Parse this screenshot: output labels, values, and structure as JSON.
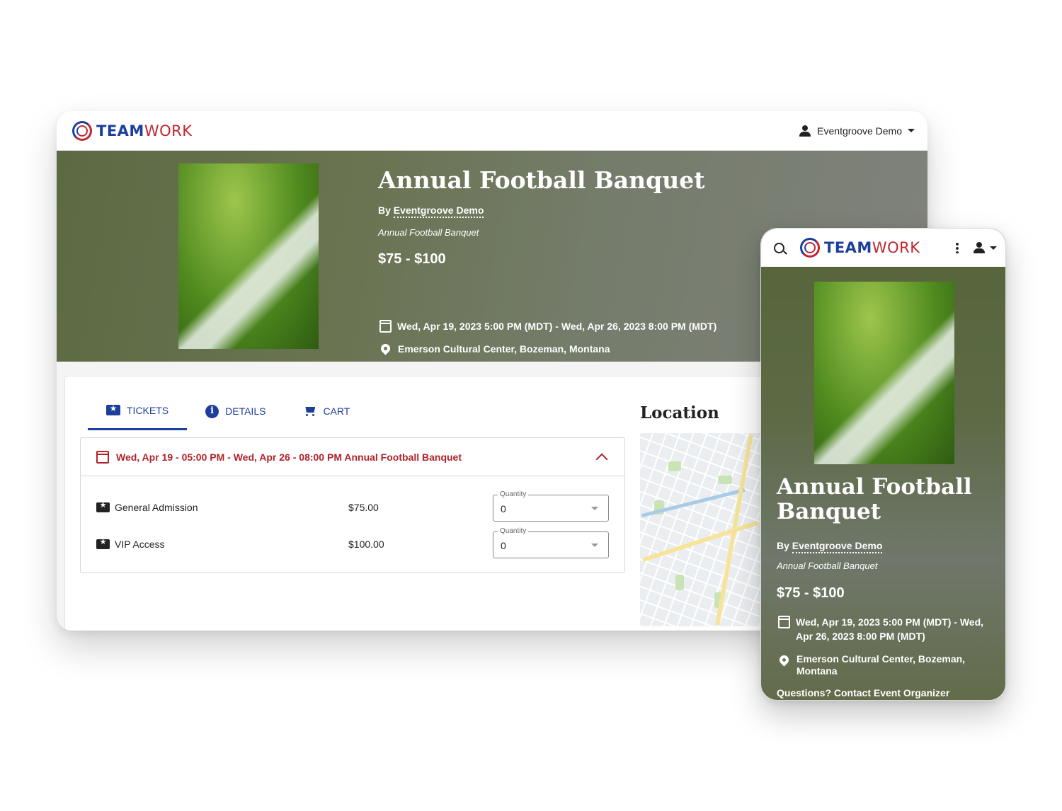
{
  "brand": {
    "part1": "TEAM",
    "part2": "WORK",
    "primary_color": "#1d3f9b",
    "accent_color": "#c0262f"
  },
  "user_menu": {
    "name": "Eventgroove Demo",
    "icon": "person-icon"
  },
  "event": {
    "title": "Annual Football Banquet",
    "by_prefix": "By",
    "organizer": "Eventgroove Demo",
    "subtitle": "Annual Football Banquet",
    "price_range": "$75 - $100",
    "date_range": "Wed, Apr 19, 2023 5:00 PM (MDT) - Wed, Apr 26, 2023 8:00 PM (MDT)",
    "location": "Emerson Cultural Center, Bozeman, Montana"
  },
  "tabs": [
    {
      "label": "TICKETS",
      "icon": "ticket-icon",
      "active": true
    },
    {
      "label": "DETAILS",
      "icon": "info-icon",
      "active": false
    },
    {
      "label": "CART",
      "icon": "cart-icon",
      "active": false
    }
  ],
  "session": {
    "label": "Wed, Apr 19 - 05:00 PM - Wed, Apr 26 - 08:00 PM Annual Football Banquet",
    "tickets": [
      {
        "name": "General Admission",
        "price": "$75.00",
        "quantity_label": "Quantity",
        "quantity": "0"
      },
      {
        "name": "VIP Access",
        "price": "$100.00",
        "quantity_label": "Quantity",
        "quantity": "0"
      }
    ]
  },
  "location_section": {
    "title": "Location"
  },
  "mobile": {
    "title": "Annual Football Banquet",
    "date_range": "Wed, Apr 19, 2023 5:00 PM (MDT) - Wed, Apr 26, 2023 8:00 PM (MDT)",
    "location": "Emerson Cultural Center, Bozeman, Montana",
    "contact": "Questions? Contact Event Organizer"
  }
}
